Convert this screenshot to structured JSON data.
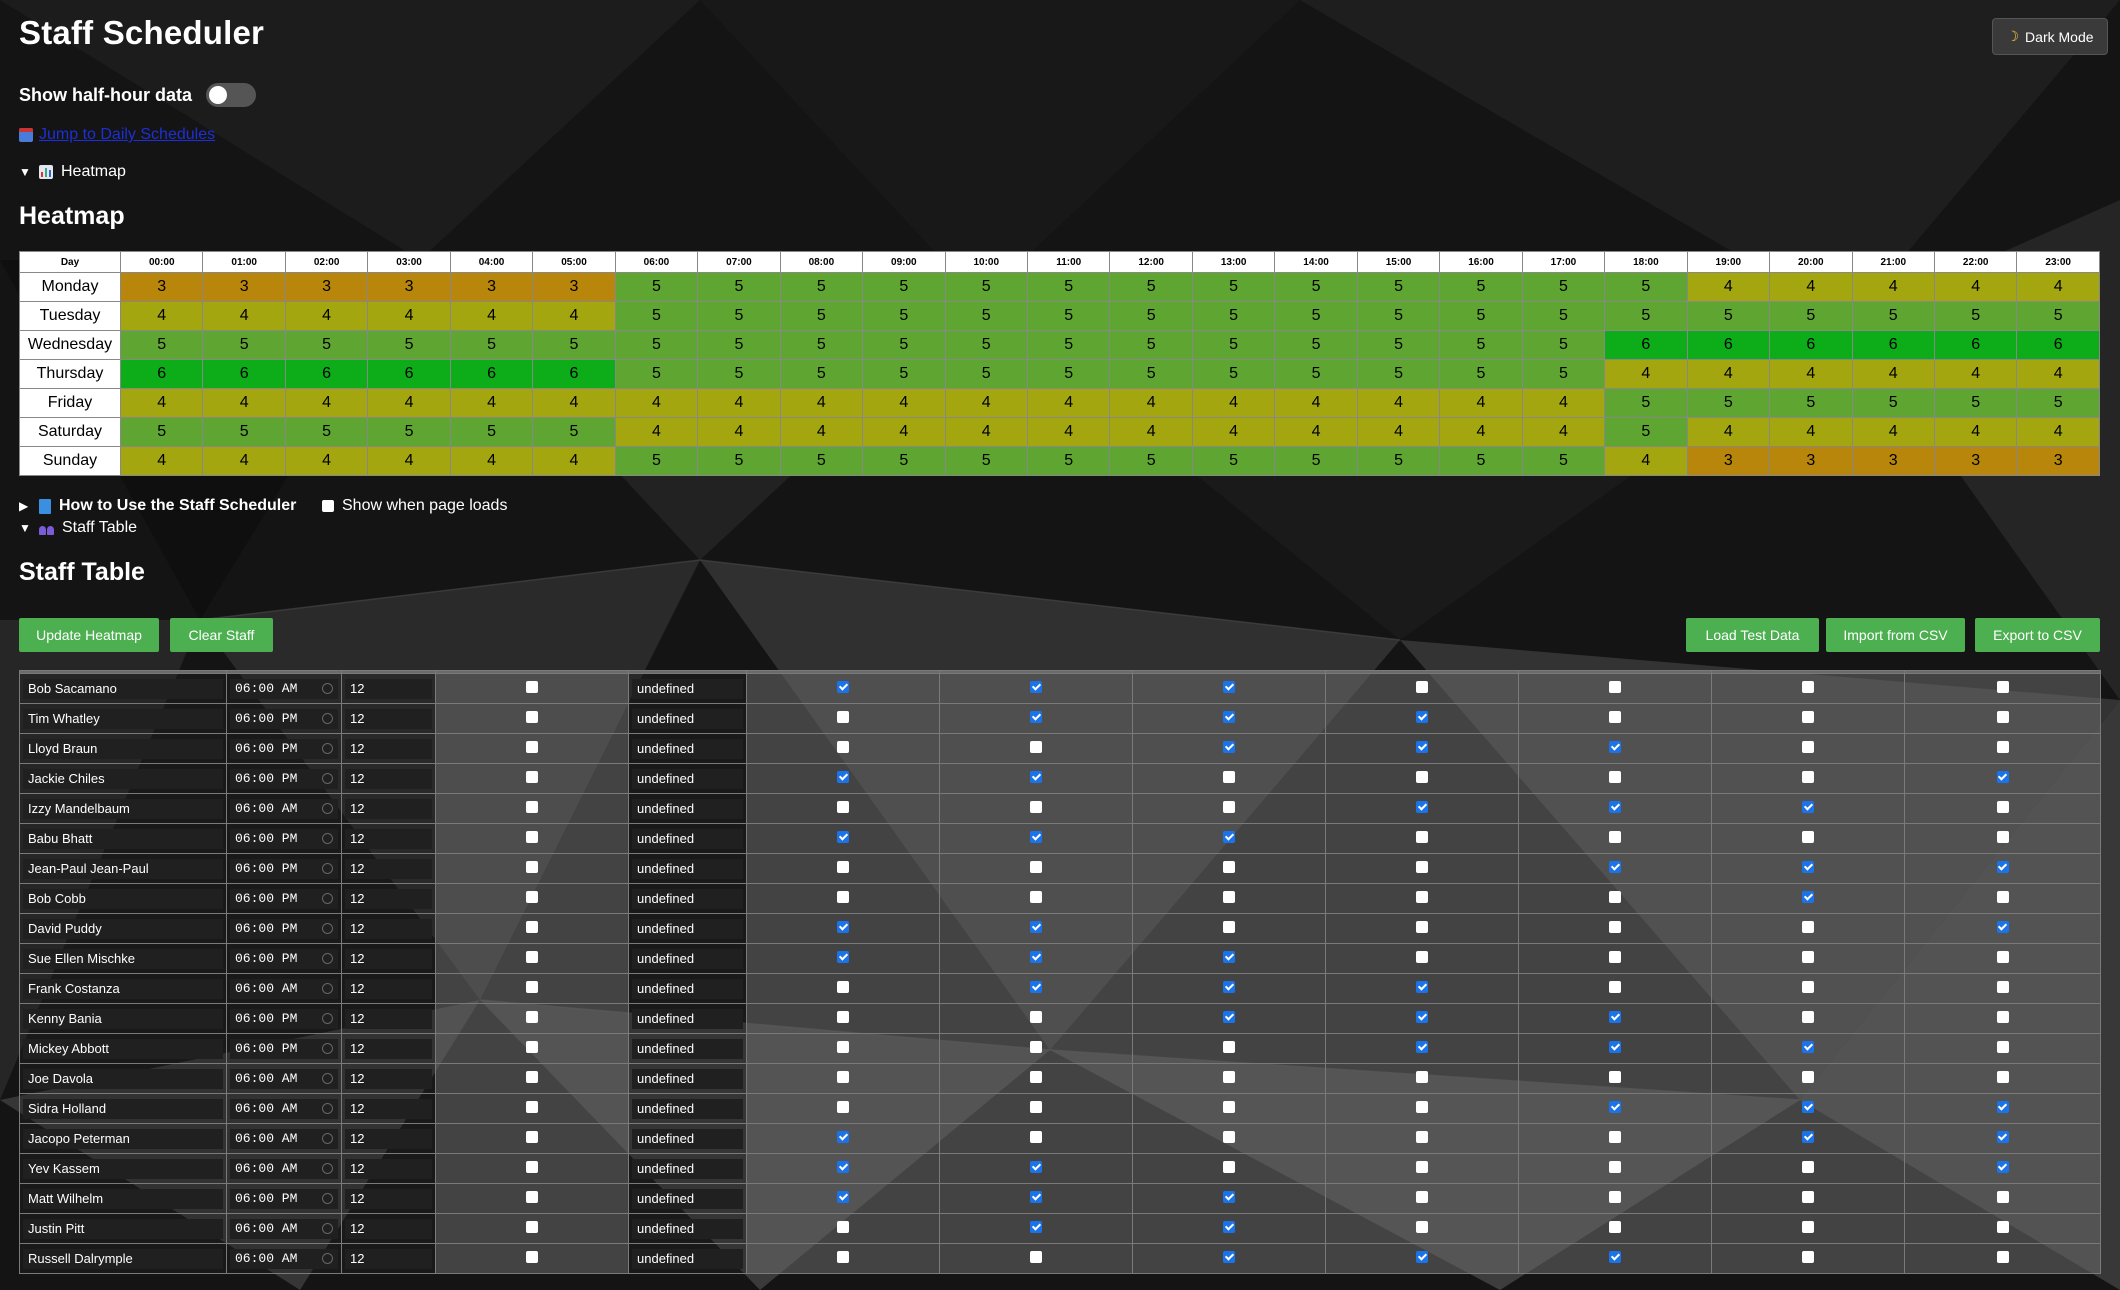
{
  "app": {
    "title": "Staff Scheduler",
    "dark_mode_label": "Dark Mode"
  },
  "options": {
    "half_hour_label": "Show half-hour data",
    "half_hour_enabled": false
  },
  "jump_link": "Jump to Daily Schedules",
  "heatmap": {
    "summary_label": "Heatmap",
    "heading": "Heatmap",
    "day_header": "Day",
    "hours": [
      "00:00",
      "01:00",
      "02:00",
      "03:00",
      "04:00",
      "05:00",
      "06:00",
      "07:00",
      "08:00",
      "09:00",
      "10:00",
      "11:00",
      "12:00",
      "13:00",
      "14:00",
      "15:00",
      "16:00",
      "17:00",
      "18:00",
      "19:00",
      "20:00",
      "21:00",
      "22:00",
      "23:00"
    ],
    "rows": [
      {
        "day": "Monday",
        "values": [
          3,
          3,
          3,
          3,
          3,
          3,
          5,
          5,
          5,
          5,
          5,
          5,
          5,
          5,
          5,
          5,
          5,
          5,
          5,
          4,
          4,
          4,
          4,
          4
        ]
      },
      {
        "day": "Tuesday",
        "values": [
          4,
          4,
          4,
          4,
          4,
          4,
          5,
          5,
          5,
          5,
          5,
          5,
          5,
          5,
          5,
          5,
          5,
          5,
          5,
          5,
          5,
          5,
          5,
          5
        ]
      },
      {
        "day": "Wednesday",
        "values": [
          5,
          5,
          5,
          5,
          5,
          5,
          5,
          5,
          5,
          5,
          5,
          5,
          5,
          5,
          5,
          5,
          5,
          5,
          6,
          6,
          6,
          6,
          6,
          6
        ]
      },
      {
        "day": "Thursday",
        "values": [
          6,
          6,
          6,
          6,
          6,
          6,
          5,
          5,
          5,
          5,
          5,
          5,
          5,
          5,
          5,
          5,
          5,
          5,
          4,
          4,
          4,
          4,
          4,
          4
        ]
      },
      {
        "day": "Friday",
        "values": [
          4,
          4,
          4,
          4,
          4,
          4,
          4,
          4,
          4,
          4,
          4,
          4,
          4,
          4,
          4,
          4,
          4,
          4,
          5,
          5,
          5,
          5,
          5,
          5
        ]
      },
      {
        "day": "Saturday",
        "values": [
          5,
          5,
          5,
          5,
          5,
          5,
          4,
          4,
          4,
          4,
          4,
          4,
          4,
          4,
          4,
          4,
          4,
          4,
          5,
          4,
          4,
          4,
          4,
          4
        ]
      },
      {
        "day": "Sunday",
        "values": [
          4,
          4,
          4,
          4,
          4,
          4,
          5,
          5,
          5,
          5,
          5,
          5,
          5,
          5,
          5,
          5,
          5,
          5,
          4,
          3,
          3,
          3,
          3,
          3
        ]
      }
    ],
    "colors": {
      "3": "#b8860b",
      "4": "#a3a60f",
      "5": "#5ea631",
      "6": "#0cad18"
    }
  },
  "howto": {
    "label": "How to Use the Staff Scheduler",
    "show_on_load_label": "Show when page loads",
    "show_on_load": false
  },
  "staff": {
    "summary_label": "Staff Table",
    "heading": "Staff Table",
    "buttons": {
      "update": "Update Heatmap",
      "clear": "Clear Staff",
      "load_test": "Load Test Data",
      "import_csv": "Import from CSV",
      "export_csv": "Export to CSV"
    },
    "rows": [
      {
        "name": "Bob Sacamano",
        "start": "06:00 AM",
        "hours": "12",
        "flag": false,
        "value": "undefined",
        "days": [
          true,
          true,
          true,
          false,
          false,
          false,
          false
        ]
      },
      {
        "name": "Tim Whatley",
        "start": "06:00 PM",
        "hours": "12",
        "flag": false,
        "value": "undefined",
        "days": [
          false,
          true,
          true,
          true,
          false,
          false,
          false
        ]
      },
      {
        "name": "Lloyd Braun",
        "start": "06:00 PM",
        "hours": "12",
        "flag": false,
        "value": "undefined",
        "days": [
          false,
          false,
          true,
          true,
          true,
          false,
          false
        ]
      },
      {
        "name": "Jackie Chiles",
        "start": "06:00 PM",
        "hours": "12",
        "flag": false,
        "value": "undefined",
        "days": [
          true,
          true,
          false,
          false,
          false,
          false,
          true
        ]
      },
      {
        "name": "Izzy Mandelbaum",
        "start": "06:00 AM",
        "hours": "12",
        "flag": false,
        "value": "undefined",
        "days": [
          false,
          false,
          false,
          true,
          true,
          true,
          false
        ]
      },
      {
        "name": "Babu Bhatt",
        "start": "06:00 PM",
        "hours": "12",
        "flag": false,
        "value": "undefined",
        "days": [
          true,
          true,
          true,
          false,
          false,
          false,
          false
        ]
      },
      {
        "name": "Jean-Paul Jean-Paul",
        "start": "06:00 PM",
        "hours": "12",
        "flag": false,
        "value": "undefined",
        "days": [
          false,
          false,
          false,
          false,
          true,
          true,
          true
        ]
      },
      {
        "name": "Bob Cobb",
        "start": "06:00 PM",
        "hours": "12",
        "flag": false,
        "value": "undefined",
        "days": [
          false,
          false,
          false,
          false,
          false,
          true,
          false
        ]
      },
      {
        "name": "David Puddy",
        "start": "06:00 PM",
        "hours": "12",
        "flag": false,
        "value": "undefined",
        "days": [
          true,
          true,
          false,
          false,
          false,
          false,
          true
        ]
      },
      {
        "name": "Sue Ellen Mischke",
        "start": "06:00 PM",
        "hours": "12",
        "flag": false,
        "value": "undefined",
        "days": [
          true,
          true,
          true,
          false,
          false,
          false,
          false
        ]
      },
      {
        "name": "Frank Costanza",
        "start": "06:00 AM",
        "hours": "12",
        "flag": false,
        "value": "undefined",
        "days": [
          false,
          true,
          true,
          true,
          false,
          false,
          false
        ]
      },
      {
        "name": "Kenny Bania",
        "start": "06:00 PM",
        "hours": "12",
        "flag": false,
        "value": "undefined",
        "days": [
          false,
          false,
          true,
          true,
          true,
          false,
          false
        ]
      },
      {
        "name": "Mickey Abbott",
        "start": "06:00 PM",
        "hours": "12",
        "flag": false,
        "value": "undefined",
        "days": [
          false,
          false,
          false,
          true,
          true,
          true,
          false
        ]
      },
      {
        "name": "Joe Davola",
        "start": "06:00 AM",
        "hours": "12",
        "flag": false,
        "value": "undefined",
        "days": [
          false,
          false,
          false,
          false,
          false,
          false,
          false
        ]
      },
      {
        "name": "Sidra Holland",
        "start": "06:00 AM",
        "hours": "12",
        "flag": false,
        "value": "undefined",
        "days": [
          false,
          false,
          false,
          false,
          true,
          true,
          true
        ]
      },
      {
        "name": "Jacopo Peterman",
        "start": "06:00 AM",
        "hours": "12",
        "flag": false,
        "value": "undefined",
        "days": [
          true,
          false,
          false,
          false,
          false,
          true,
          true
        ]
      },
      {
        "name": "Yev Kassem",
        "start": "06:00 AM",
        "hours": "12",
        "flag": false,
        "value": "undefined",
        "days": [
          true,
          true,
          false,
          false,
          false,
          false,
          true
        ]
      },
      {
        "name": "Matt Wilhelm",
        "start": "06:00 PM",
        "hours": "12",
        "flag": false,
        "value": "undefined",
        "days": [
          true,
          true,
          true,
          false,
          false,
          false,
          false
        ]
      },
      {
        "name": "Justin Pitt",
        "start": "06:00 AM",
        "hours": "12",
        "flag": false,
        "value": "undefined",
        "days": [
          false,
          true,
          true,
          false,
          false,
          false,
          false
        ]
      },
      {
        "name": "Russell Dalrymple",
        "start": "06:00 AM",
        "hours": "12",
        "flag": false,
        "value": "undefined",
        "days": [
          false,
          false,
          true,
          true,
          true,
          false,
          false
        ]
      }
    ]
  }
}
